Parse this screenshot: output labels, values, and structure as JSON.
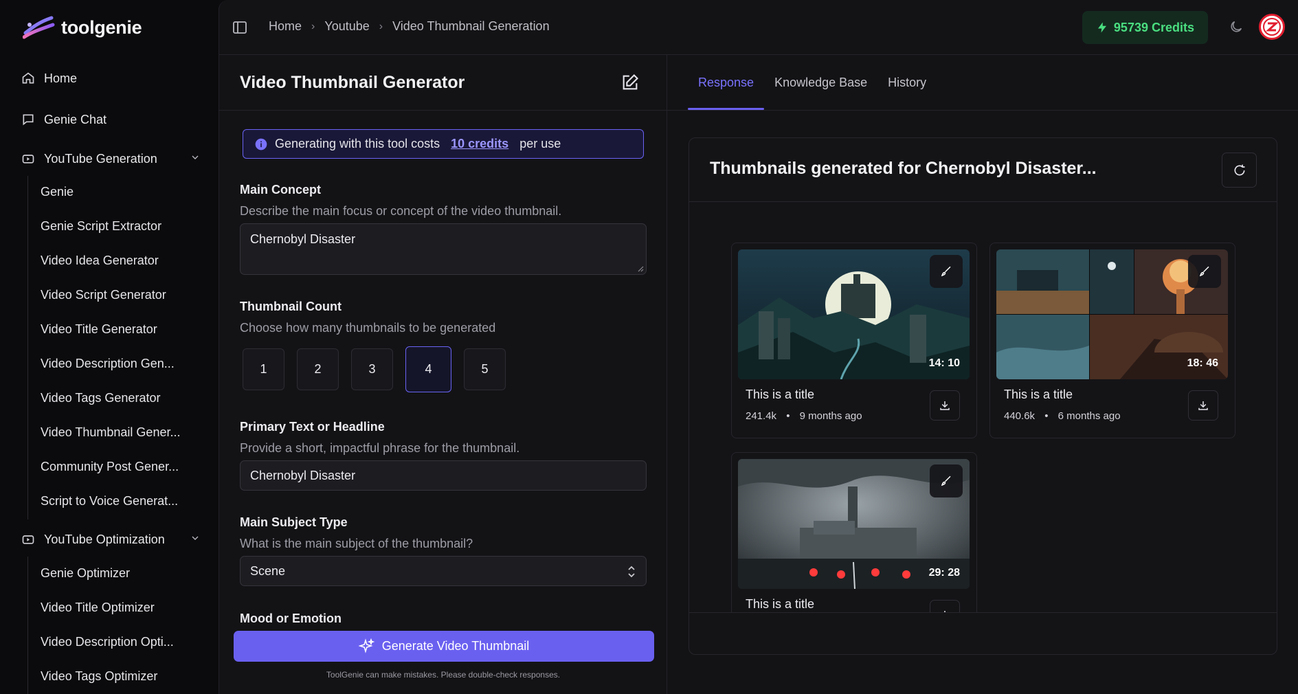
{
  "app": {
    "name": "toolgenie"
  },
  "sidebar": {
    "home": "Home",
    "genie_chat": "Genie Chat",
    "youtube_generation": {
      "label": "YouTube Generation",
      "items": [
        "Genie",
        "Genie Script Extractor",
        "Video Idea Generator",
        "Video Script Generator",
        "Video Title Generator",
        "Video Description Gen...",
        "Video Tags Generator",
        "Video Thumbnail Gener...",
        "Community Post Gener...",
        "Script to Voice Generat..."
      ]
    },
    "youtube_optimization": {
      "label": "YouTube Optimization",
      "items": [
        "Genie Optimizer",
        "Video Title Optimizer",
        "Video Description Opti...",
        "Video Tags Optimizer"
      ]
    }
  },
  "topbar": {
    "breadcrumbs": [
      "Home",
      "Youtube",
      "Video Thumbnail Generation"
    ],
    "credits": "95739 Credits"
  },
  "form": {
    "title": "Video Thumbnail Generator",
    "info_prefix": "Generating with this tool costs",
    "info_credits": "10 credits",
    "info_suffix": "per use",
    "main_concept": {
      "label": "Main Concept",
      "desc": "Describe the main focus or concept of the video thumbnail.",
      "value": "Chernobyl Disaster"
    },
    "thumbnail_count": {
      "label": "Thumbnail Count",
      "desc": "Choose how many thumbnails to be generated",
      "options": [
        "1",
        "2",
        "3",
        "4",
        "5"
      ],
      "selected": "4"
    },
    "primary_text": {
      "label": "Primary Text or Headline",
      "desc": "Provide a short, impactful phrase for the thumbnail.",
      "value": "Chernobyl Disaster"
    },
    "subject_type": {
      "label": "Main Subject Type",
      "desc": "What is the main subject of the thumbnail?",
      "value": "Scene"
    },
    "mood": {
      "label": "Mood or Emotion"
    },
    "generate_label": "Generate Video Thumbnail",
    "disclaimer": "ToolGenie can make mistakes. Please double-check responses."
  },
  "response": {
    "tabs": [
      "Response",
      "Knowledge Base",
      "History"
    ],
    "active_tab": "Response",
    "card_title": "Thumbnails generated for Chernobyl Disaster...",
    "thumbnails": [
      {
        "title": "This is a title",
        "views": "241.4k",
        "age": "9 months ago",
        "duration": "14: 10"
      },
      {
        "title": "This is a title",
        "views": "440.6k",
        "age": "6 months ago",
        "duration": "18: 46"
      },
      {
        "title": "This is a title",
        "views": "",
        "age": "",
        "duration": "29: 28"
      }
    ]
  },
  "colors": {
    "accent": "#6a60f0",
    "credits_green": "#4ade80",
    "background": "#131316"
  }
}
